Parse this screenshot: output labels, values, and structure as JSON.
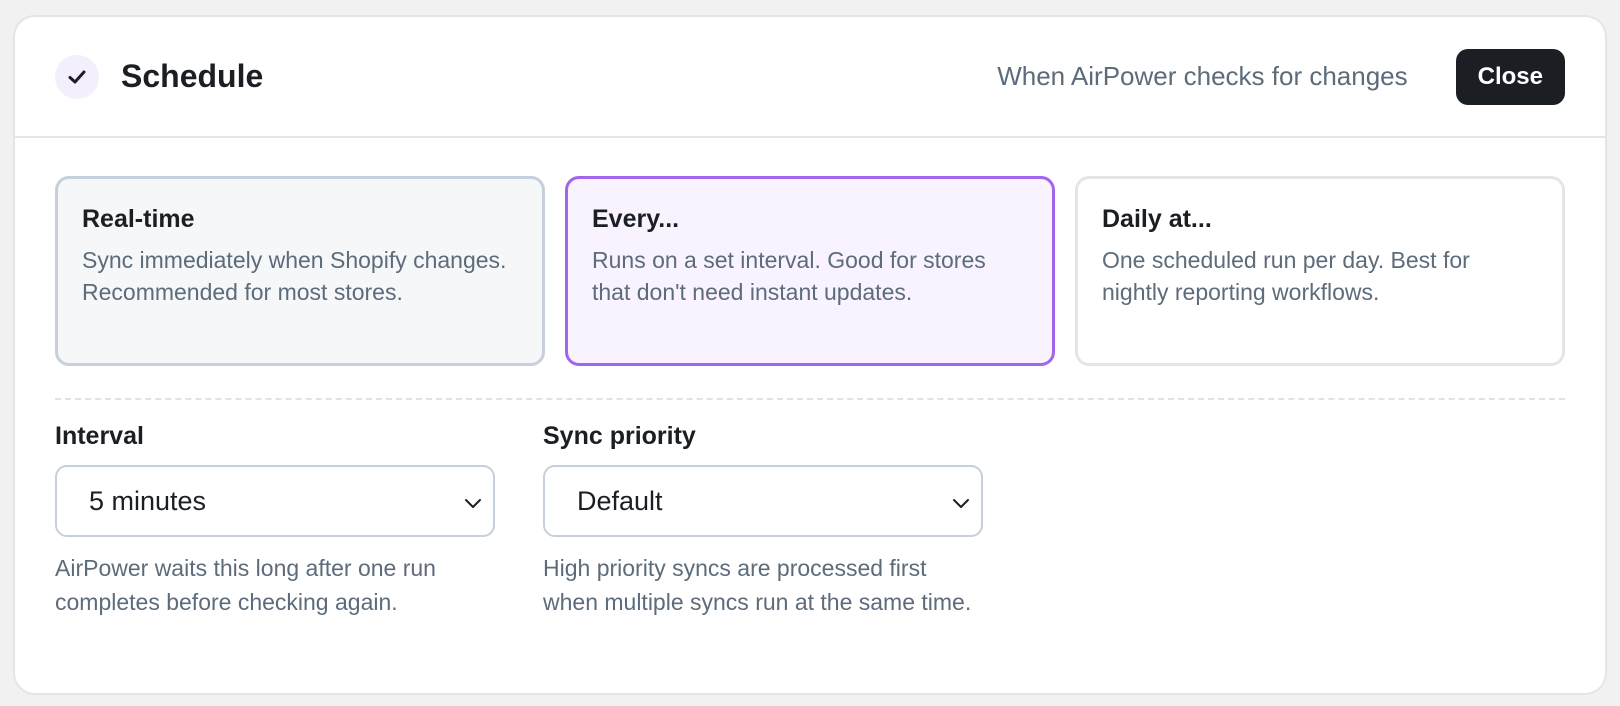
{
  "header": {
    "title": "Schedule",
    "subtitle": "When AirPower checks for changes",
    "close_label": "Close"
  },
  "options": [
    {
      "title": "Real-time",
      "description": "Sync immediately when Shopify changes. Recommended for most stores."
    },
    {
      "title": "Every...",
      "description": "Runs on a set interval. Good for stores that don't need instant updates."
    },
    {
      "title": "Daily at...",
      "description": "One scheduled run per day. Best for nightly reporting workflows."
    }
  ],
  "interval": {
    "label": "Interval",
    "value": "5 minutes",
    "help": "AirPower waits this long after one run completes before checking again."
  },
  "priority": {
    "label": "Sync priority",
    "value": "Default",
    "help": "High priority syncs are processed first when multiple syncs run at the same time."
  },
  "colors": {
    "accent": "#a266ec",
    "accent_bg": "#f8f3fe",
    "dark": "#1b1f24",
    "muted_text": "#5d6b7a"
  },
  "icons": {
    "header_badge": "check-icon",
    "select_arrow": "chevron-down-icon"
  }
}
